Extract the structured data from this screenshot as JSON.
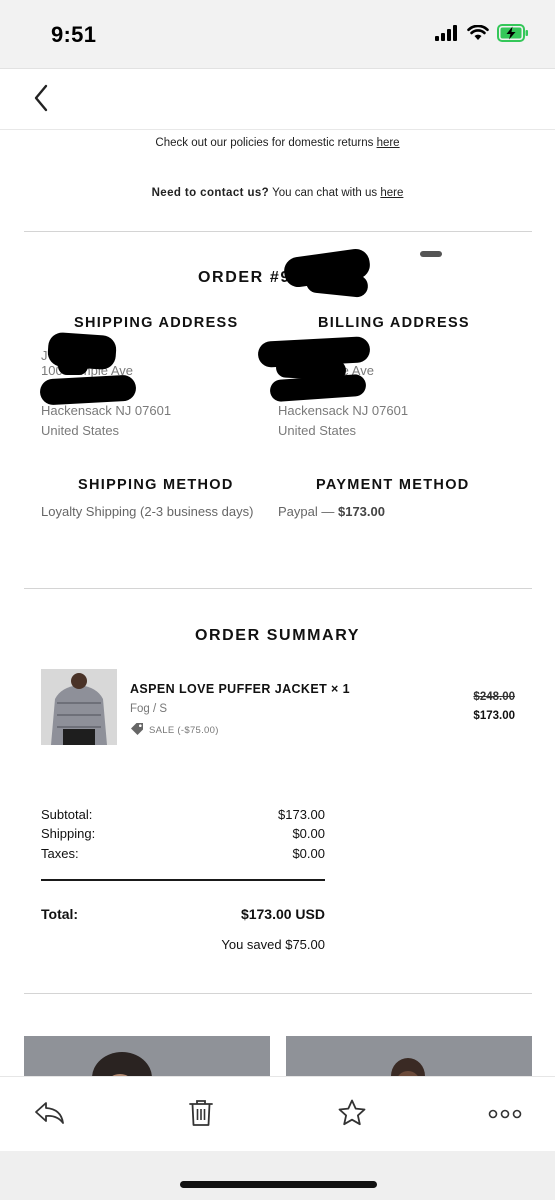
{
  "status_bar": {
    "time": "9:51"
  },
  "nav": {
    "back_icon": "chevron-left-icon"
  },
  "policies": {
    "returns_text": "Check out our policies for domestic returns ",
    "returns_link": "here",
    "contact_lead": "Need to contact us?",
    "contact_text": " You can chat with us ",
    "contact_link": "here"
  },
  "order": {
    "title": "ORDER #9"
  },
  "shipping_address": {
    "heading": "SHIPPING ADDRESS",
    "name_initial": "J",
    "street_partial": "100 Temple Ave",
    "city": "Hackensack NJ 07601",
    "country": "United States"
  },
  "billing_address": {
    "heading": "BILLING ADDRESS",
    "street_partial": "Temple Ave",
    "city": "Hackensack NJ 07601",
    "country": "United States"
  },
  "shipping_method": {
    "heading": "SHIPPING METHOD",
    "value": "Loyalty Shipping (2-3 business days)"
  },
  "payment_method": {
    "heading": "PAYMENT METHOD",
    "provider": "Paypal — ",
    "amount": "$173.00"
  },
  "summary": {
    "heading": "ORDER SUMMARY",
    "item": {
      "name": "ASPEN LOVE PUFFER JACKET × 1",
      "variant": "Fog / S",
      "sale_label": "SALE (-$75.00)",
      "original_price": "$248.00",
      "price": "$173.00"
    },
    "totals": {
      "subtotal_label": "Subtotal:",
      "subtotal": "$173.00",
      "shipping_label": "Shipping:",
      "shipping": "$0.00",
      "taxes_label": "Taxes:",
      "taxes": "$0.00",
      "total_label": "Total:",
      "total": "$173.00 USD",
      "saved": "You saved $75.00"
    }
  },
  "toolbar": {
    "reply_icon": "reply-icon",
    "trash_icon": "trash-icon",
    "star_icon": "star-icon",
    "more_icon": "more-icon"
  },
  "colors": {
    "muted_text": "#7a7a7a",
    "divider": "#d4d4d4",
    "battery_green": "#34c759"
  }
}
